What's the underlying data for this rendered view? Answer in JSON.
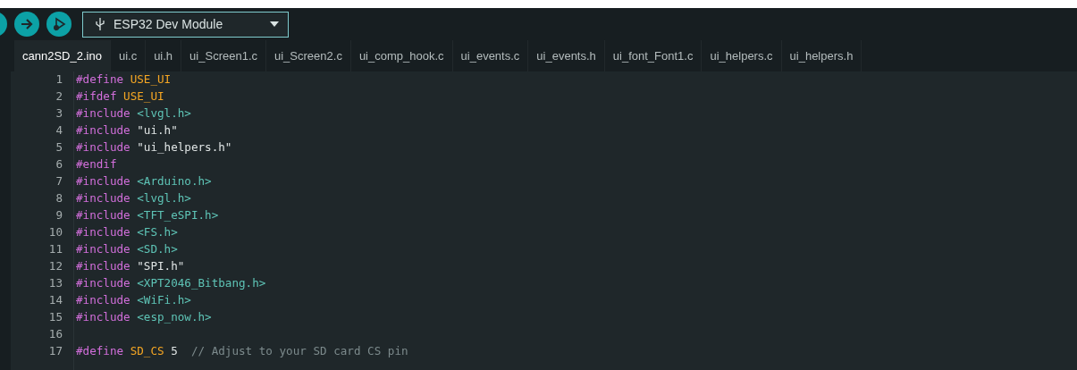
{
  "toolbar": {
    "board_selector": {
      "value": "ESP32 Dev Module"
    }
  },
  "tabs": [
    {
      "label": "cann2SD_2.ino",
      "selected": true
    },
    {
      "label": "ui.c",
      "selected": false
    },
    {
      "label": "ui.h",
      "selected": false
    },
    {
      "label": "ui_Screen1.c",
      "selected": false
    },
    {
      "label": "ui_Screen2.c",
      "selected": false
    },
    {
      "label": "ui_comp_hook.c",
      "selected": false
    },
    {
      "label": "ui_events.c",
      "selected": false
    },
    {
      "label": "ui_events.h",
      "selected": false
    },
    {
      "label": "ui_font_Font1.c",
      "selected": false
    },
    {
      "label": "ui_helpers.c",
      "selected": false
    },
    {
      "label": "ui_helpers.h",
      "selected": false
    }
  ],
  "editor": {
    "lines": [
      {
        "number": "1",
        "tokens": [
          {
            "kind": "directive",
            "text": "#define"
          },
          {
            "kind": "macro",
            "text": "USE_UI"
          }
        ]
      },
      {
        "number": "2",
        "tokens": [
          {
            "kind": "directive",
            "text": "#ifdef"
          },
          {
            "kind": "macro",
            "text": "USE_UI"
          }
        ]
      },
      {
        "number": "3",
        "tokens": [
          {
            "kind": "directive",
            "text": "#include"
          },
          {
            "kind": "header",
            "text": "<lvgl.h>"
          }
        ]
      },
      {
        "number": "4",
        "tokens": [
          {
            "kind": "directive",
            "text": "#include"
          },
          {
            "kind": "string",
            "text": "\"ui.h\""
          }
        ]
      },
      {
        "number": "5",
        "tokens": [
          {
            "kind": "directive",
            "text": "#include"
          },
          {
            "kind": "string",
            "text": "\"ui_helpers.h\""
          }
        ]
      },
      {
        "number": "6",
        "tokens": [
          {
            "kind": "directive",
            "text": "#endif"
          }
        ]
      },
      {
        "number": "7",
        "tokens": [
          {
            "kind": "directive",
            "text": "#include"
          },
          {
            "kind": "header",
            "text": "<Arduino.h>"
          }
        ]
      },
      {
        "number": "8",
        "tokens": [
          {
            "kind": "directive",
            "text": "#include"
          },
          {
            "kind": "header",
            "text": "<lvgl.h>"
          }
        ]
      },
      {
        "number": "9",
        "tokens": [
          {
            "kind": "directive",
            "text": "#include"
          },
          {
            "kind": "header",
            "text": "<TFT_eSPI.h>"
          }
        ]
      },
      {
        "number": "10",
        "tokens": [
          {
            "kind": "directive",
            "text": "#include"
          },
          {
            "kind": "header",
            "text": "<FS.h>"
          }
        ]
      },
      {
        "number": "11",
        "tokens": [
          {
            "kind": "directive",
            "text": "#include"
          },
          {
            "kind": "header",
            "text": "<SD.h>"
          }
        ]
      },
      {
        "number": "12",
        "tokens": [
          {
            "kind": "directive",
            "text": "#include"
          },
          {
            "kind": "string",
            "text": "\"SPI.h\""
          }
        ]
      },
      {
        "number": "13",
        "tokens": [
          {
            "kind": "directive",
            "text": "#include"
          },
          {
            "kind": "header",
            "text": "<XPT2046_Bitbang.h>"
          }
        ]
      },
      {
        "number": "14",
        "tokens": [
          {
            "kind": "directive",
            "text": "#include"
          },
          {
            "kind": "header",
            "text": "<WiFi.h>"
          }
        ]
      },
      {
        "number": "15",
        "tokens": [
          {
            "kind": "directive",
            "text": "#include"
          },
          {
            "kind": "header",
            "text": "<esp_now.h>"
          }
        ]
      },
      {
        "number": "16"
      },
      {
        "number": "17",
        "tokens": [
          {
            "kind": "directive",
            "text": "#define"
          },
          {
            "kind": "macro",
            "text": "SD_CS"
          },
          {
            "kind": "number",
            "text": "5"
          },
          {
            "kind": "comment",
            "text": " // Adjust to your SD card CS pin"
          }
        ]
      }
    ]
  }
}
